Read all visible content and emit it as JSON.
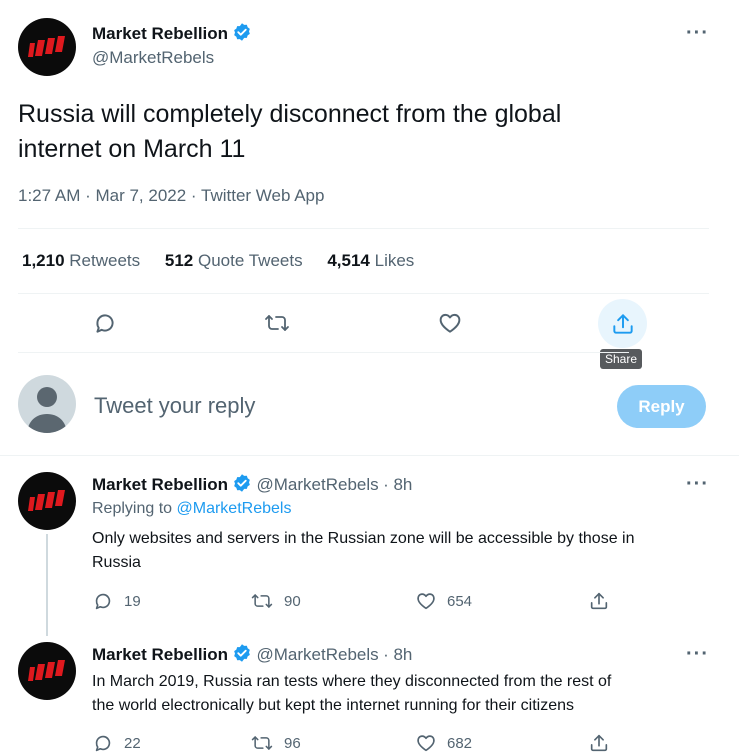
{
  "main_tweet": {
    "author_name": "Market Rebellion",
    "author_handle": "@MarketRebels",
    "text_line1": "Russia will completely disconnect from the global",
    "text_line2": "internet on March 11",
    "timestamp": "1:27 AM · Mar 7, 2022 · Twitter Web App",
    "retweets_count": "1,210",
    "retweets_label": "Retweets",
    "quotes_count": "512",
    "quotes_label": "Quote Tweets",
    "likes_count": "4,514",
    "likes_label": "Likes",
    "more_label": "···"
  },
  "actions": {
    "share_tooltip": "Share"
  },
  "reply_box": {
    "placeholder": "Tweet your reply",
    "button_label": "Reply"
  },
  "replies": [
    {
      "author_name": "Market Rebellion",
      "author_handle": "@MarketRebels",
      "time": "· 8h",
      "replying_prefix": "Replying to",
      "replying_handle": "@MarketRebels",
      "text_line1": "Only websites and servers in the Russian zone will be accessible by those in",
      "text_line2": "Russia",
      "reply_count": "19",
      "retweet_count": "90",
      "like_count": "654",
      "more_label": "···"
    },
    {
      "author_name": "Market Rebellion",
      "author_handle": "@MarketRebels",
      "time": "· 8h",
      "text_line1": "In March 2019, Russia ran tests where they disconnected from the rest of",
      "text_line2": "the world electronically but kept the internet running for their citizens",
      "reply_count": "22",
      "retweet_count": "96",
      "like_count": "682",
      "more_label": "···"
    }
  ],
  "colors": {
    "accent": "#1d9bf0",
    "reply_button_disabled": "#8ecdf8",
    "text_secondary": "#536471",
    "logo_red": "#e0191e"
  }
}
